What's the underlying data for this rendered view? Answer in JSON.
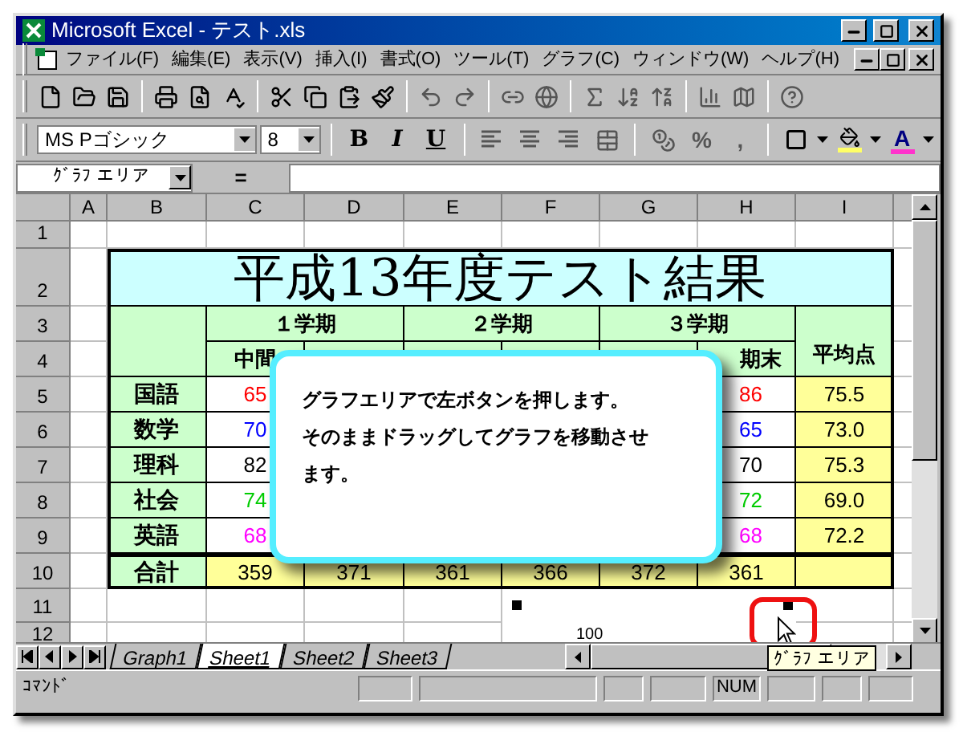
{
  "window": {
    "title": "Microsoft Excel - テスト.xls"
  },
  "menu": [
    "ファイル(F)",
    "編集(E)",
    "表示(V)",
    "挿入(I)",
    "書式(O)",
    "ツール(T)",
    "グラフ(C)",
    "ウィンドウ(W)",
    "ヘルプ(H)"
  ],
  "format_toolbar": {
    "font": "MS Pゴシック",
    "size": "8",
    "style_buttons": [
      "B",
      "I",
      "U"
    ],
    "number_buttons": [
      "%",
      ","
    ],
    "font_color_button": "A"
  },
  "formula_bar": {
    "name_box": "ｸﾞﾗﾌ エリア",
    "equals": "="
  },
  "sheet": {
    "columns": [
      "A",
      "B",
      "C",
      "D",
      "E",
      "F",
      "G",
      "H",
      "I"
    ],
    "rows": [
      "1",
      "2",
      "3",
      "4",
      "5",
      "6",
      "7",
      "8",
      "9",
      "10",
      "11",
      "12"
    ],
    "title": "平成13年度テスト結果",
    "terms": [
      "１学期",
      "２学期",
      "３学期"
    ],
    "subheads": [
      "中間",
      "期末"
    ],
    "average_header": "平均点",
    "subjects": [
      {
        "name": "国語",
        "first": "65",
        "last": "86",
        "average": "75.5",
        "color": "#ff0000"
      },
      {
        "name": "数学",
        "first": "70",
        "last": "65",
        "average": "73.0",
        "color": "#0000ff"
      },
      {
        "name": "理科",
        "first": "82",
        "last": "70",
        "average": "75.3",
        "color": "#000000"
      },
      {
        "name": "社会",
        "first": "74",
        "last": "72",
        "average": "69.0",
        "color": "#00cc00"
      },
      {
        "name": "英語",
        "first": "68",
        "last": "68",
        "average": "72.2",
        "color": "#ff00ff"
      }
    ],
    "total": {
      "label": "合計",
      "values": [
        "359",
        "371",
        "361",
        "366",
        "372",
        "361"
      ]
    },
    "chart_axis_label": "100"
  },
  "callout": {
    "lines": [
      "グラフエリアで左ボタンを押します。",
      "そのままドラッグしてグラフを移動させ",
      "ます。"
    ]
  },
  "sheet_tabs": [
    {
      "label": "Graph1",
      "selected": false
    },
    {
      "label": "Sheet1",
      "selected": true
    },
    {
      "label": "Sheet2",
      "selected": false
    },
    {
      "label": "Sheet3",
      "selected": false
    }
  ],
  "tooltip": "ｸﾞﾗﾌ エリア",
  "status_bar": {
    "text": "ｺﾏﾝﾄﾞ",
    "indicator": "NUM"
  }
}
